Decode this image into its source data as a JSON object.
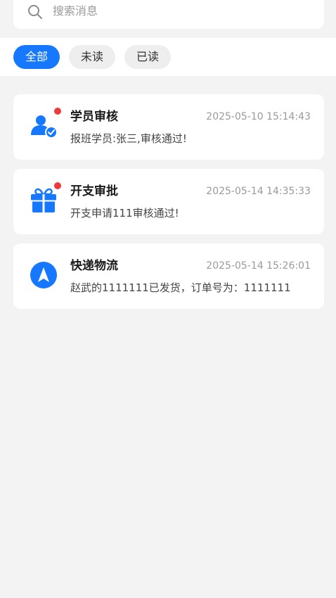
{
  "search": {
    "placeholder": "搜索消息"
  },
  "tabs": [
    {
      "label": "全部",
      "active": true
    },
    {
      "label": "未读",
      "active": false
    },
    {
      "label": "已读",
      "active": false
    }
  ],
  "messages": [
    {
      "title": "学员审核",
      "time": "2025-05-10 15:14:43",
      "content": "报班学员:张三,审核通过!",
      "icon": "student-review-icon",
      "unread": true
    },
    {
      "title": "开支审批",
      "time": "2025-05-14 14:35:33",
      "content": "开支申请111审核通过!",
      "icon": "gift-icon",
      "unread": true
    },
    {
      "title": "快递物流",
      "time": "2025-05-14 15:26:01",
      "content": "赵武的1111111已发货，订单号为：1111111",
      "icon": "navigation-arrow-icon",
      "unread": false
    }
  ],
  "colors": {
    "accent": "#1677ff",
    "unread_dot": "#ee3a3a",
    "background": "#f3f3f3"
  }
}
